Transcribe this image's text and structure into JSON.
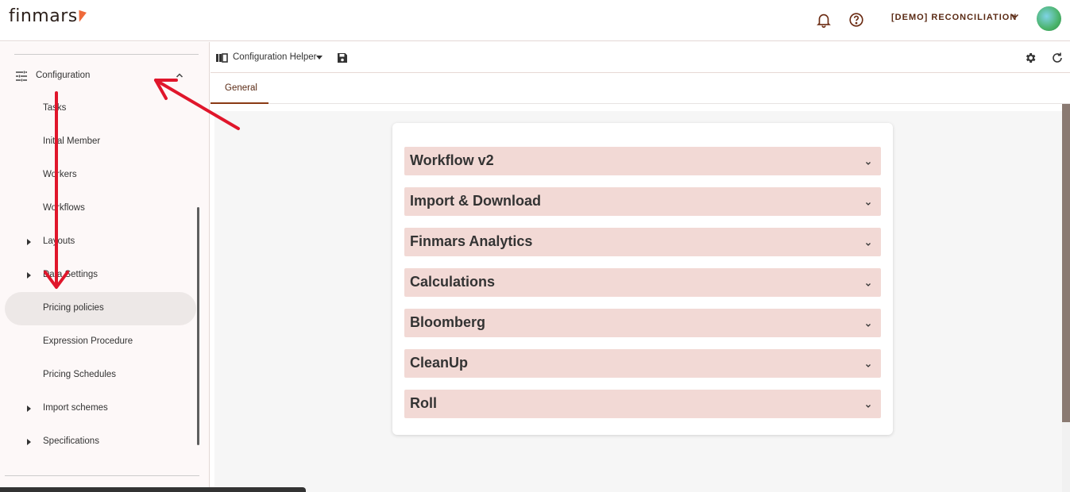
{
  "header": {
    "logo_text": "finmars",
    "workspace_label": "[DEMO] RECONCILIATION",
    "icons": [
      "bell-icon",
      "help-icon",
      "chevron-down-icon"
    ]
  },
  "sidebar": {
    "section_label": "Configuration",
    "items": [
      {
        "label": "Tasks",
        "expandable": false
      },
      {
        "label": "Initial Member",
        "expandable": false
      },
      {
        "label": "Workers",
        "expandable": false
      },
      {
        "label": "Workflows",
        "expandable": false
      },
      {
        "label": "Layouts",
        "expandable": true
      },
      {
        "label": "Data Settings",
        "expandable": true
      },
      {
        "label": "Pricing policies",
        "expandable": false,
        "active": true
      },
      {
        "label": "Expression Procedure",
        "expandable": false
      },
      {
        "label": "Pricing Schedules",
        "expandable": false
      },
      {
        "label": "Import schemes",
        "expandable": true
      },
      {
        "label": "Specifications",
        "expandable": true
      }
    ]
  },
  "toolbar": {
    "title": "Configuration Helper",
    "icons": [
      "layout-icon",
      "save-icon",
      "gear-icon",
      "refresh-icon"
    ]
  },
  "tabs": [
    {
      "label": "General",
      "active": true
    }
  ],
  "accordions": [
    {
      "label": "Workflow v2"
    },
    {
      "label": "Import & Download"
    },
    {
      "label": "Finmars Analytics"
    },
    {
      "label": "Calculations"
    },
    {
      "label": "Bloomberg"
    },
    {
      "label": "CleanUp"
    },
    {
      "label": "Roll"
    }
  ],
  "colors": {
    "accent": "#8a3a14",
    "accordion_bg": "#f2d9d5",
    "annotation_arrow": "#e0162b",
    "logo_mark": "#ef6a3a"
  }
}
